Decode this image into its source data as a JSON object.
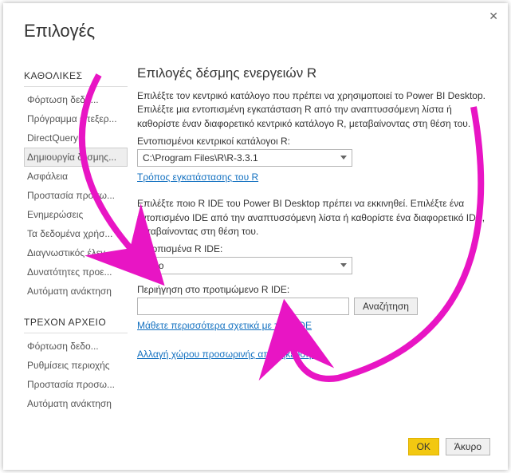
{
  "window": {
    "title": "Επιλογές",
    "close": "✕"
  },
  "sidebar": {
    "cat_global": "ΚΑΘΟΛΙΚΕΣ",
    "g": [
      "Φόρτωση δεδο...",
      "Πρόγραμμα επεξερ...",
      "DirectQuery",
      "Δημιουργία δέσμης...",
      "Ασφάλεια",
      "Προστασία προσω...",
      "Ενημερώσεις",
      "Τα δεδομένα χρήσ...",
      "Διαγνωστικός έλεγ...",
      "Δυνατότητες προε...",
      "Αυτόματη ανάκτηση"
    ],
    "cat_current": "ΤΡΕΧΟΝ ΑΡΧΕΙΟ",
    "c": [
      "Φόρτωση δεδο...",
      "Ρυθμίσεις περιοχής",
      "Προστασία προσω...",
      "Αυτόματη ανάκτηση"
    ]
  },
  "main": {
    "heading": "Επιλογές δέσμης ενεργειών R",
    "p1": "Επιλέξτε τον κεντρικό κατάλογο που πρέπει να χρησιμοποιεί το Power BI Desktop. Επιλέξτε μια εντοπισμένη εγκατάσταση R από την αναπτυσσόμενη λίστα ή καθορίστε έναν διαφορετικό κεντρικό κατάλογο R, μεταβαίνοντας στη θέση του.",
    "label_home": "Εντοπισμένοι κεντρικοί κατάλογοι R:",
    "home_value": "C:\\Program Files\\R\\R-3.3.1",
    "link_install": "Τρόπος εγκατάστασης του R",
    "p2": "Επιλέξτε ποιο R IDE του Power BI Desktop πρέπει να εκκινηθεί. Επιλέξτε ένα εντοπισμένο IDE από την αναπτυσσόμενη λίστα ή καθορίστε ένα διαφορετικό IDE, μεταβαίνοντας στη θέση του.",
    "label_ide": "Εντοπισμένα R IDE:",
    "ide_value": "Άλλο",
    "label_browse": "Περιήγηση στο προτιμώμενο R IDE:",
    "browse_btn": "Αναζήτηση",
    "link_learn": "Μάθετε περισσότερα σχετικά με τα R IDE",
    "link_temp": "Αλλαγή χώρου προσωρινής αποθήκευσης"
  },
  "footer": {
    "ok": "OK",
    "cancel": "Άκυρο"
  }
}
